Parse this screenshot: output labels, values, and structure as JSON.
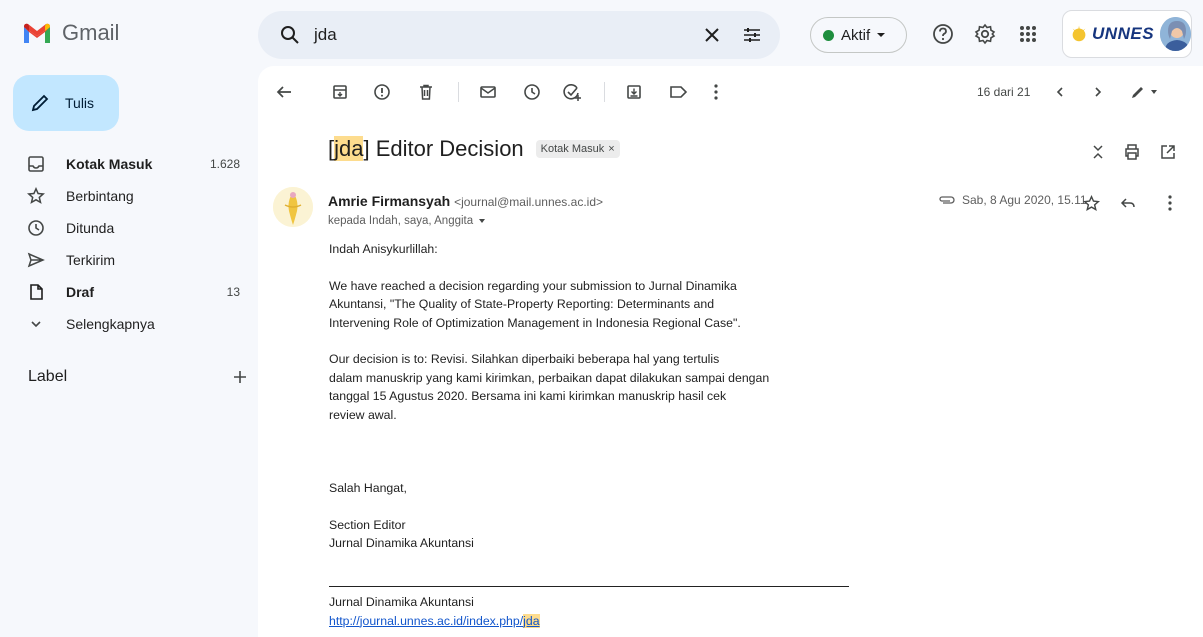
{
  "app": {
    "name": "Gmail"
  },
  "search": {
    "query": "jda"
  },
  "status": {
    "label": "Aktif",
    "color": "#1e8e3e"
  },
  "org": {
    "name": "UNNES"
  },
  "icons": {
    "search": "search-icon",
    "clear": "close-icon",
    "filter": "search-options-icon",
    "help": "help-icon",
    "settings": "gear-icon",
    "apps": "apps-grid-icon"
  },
  "sidebar": {
    "compose_label": "Tulis",
    "items": [
      {
        "label": "Kotak Masuk",
        "count": "1.628",
        "icon": "inbox-icon",
        "bold": true
      },
      {
        "label": "Berbintang",
        "count": "",
        "icon": "star-icon",
        "bold": false
      },
      {
        "label": "Ditunda",
        "count": "",
        "icon": "clock-icon",
        "bold": false
      },
      {
        "label": "Terkirim",
        "count": "",
        "icon": "send-icon",
        "bold": false
      },
      {
        "label": "Draf",
        "count": "13",
        "icon": "file-icon",
        "bold": true
      },
      {
        "label": "Selengkapnya",
        "count": "",
        "icon": "chevron-down-icon",
        "bold": false
      }
    ],
    "labels_heading": "Label"
  },
  "toolbar": {
    "pager": "16 dari 21"
  },
  "email": {
    "subject_pre": "[",
    "subject_hl": "jda",
    "subject_post": "] Editor Decision",
    "label_chip": "Kotak Masuk",
    "label_chip_close": "×",
    "sender_name": "Amrie Firmansyah",
    "sender_email": "<journal@mail.unnes.ac.id>",
    "recipients": "kepada Indah, saya, Anggita",
    "date": "Sab, 8 Agu 2020, 15.11",
    "body": {
      "greeting": "Indah Anisykurlillah:",
      "para1_lines": [
        "We have reached a decision regarding your submission to Jurnal Dinamika",
        "Akuntansi, \"The Quality of State-Property Reporting: Determinants and",
        "Intervening Role of Optimization Management in Indonesia Regional Case\"."
      ],
      "para2_lines": [
        "Our decision is to: Revisi. Silahkan diperbaiki beberapa hal yang tertulis",
        "dalam manuskrip yang kami kirimkan, perbaikan dapat dilakukan sampai dengan",
        "tanggal 15 Agustus 2020. Bersama ini kami kirimkan manuskrip hasil cek",
        "review awal."
      ],
      "closing": "Salah Hangat,",
      "sig_role": "Section Editor",
      "sig_journal": "Jurnal Dinamika Akuntansi"
    },
    "footer": {
      "journal": "Jurnal Dinamika Akuntansi",
      "link_pre": "http://journal.unnes.ac.id/index.php/",
      "link_hl": "jda"
    }
  }
}
